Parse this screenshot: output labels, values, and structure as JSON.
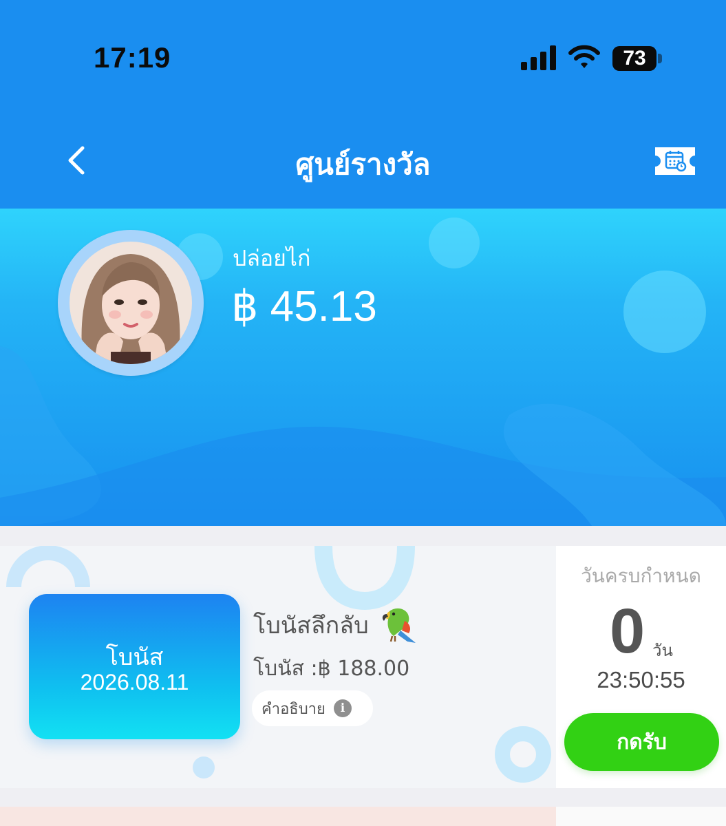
{
  "status_bar": {
    "time": "17:19",
    "battery": "73"
  },
  "nav": {
    "title": "ศูนย์รางวัล"
  },
  "user": {
    "name": "ปล่อยไก่",
    "balance": "฿ 45.13"
  },
  "bonus_card": {
    "badge_label": "โบนัส",
    "badge_date": "2026.08.11",
    "title": "โบนัสลึกลับ",
    "amount": "โบนัส :฿ 188.00",
    "description_label": "คำอธิบาย",
    "due_label": "วันครบกำหนด",
    "days": "0",
    "days_unit": "วัน",
    "countdown": "23:50:55",
    "claim_label": "กดรับ"
  },
  "colors": {
    "header": "#1a8ef0",
    "accent_green": "#32d114"
  },
  "icons": [
    "chevron-left-icon",
    "calendar-ticket-icon",
    "signal-icon",
    "wifi-icon",
    "battery-icon",
    "info-icon",
    "parrot-emoji"
  ]
}
